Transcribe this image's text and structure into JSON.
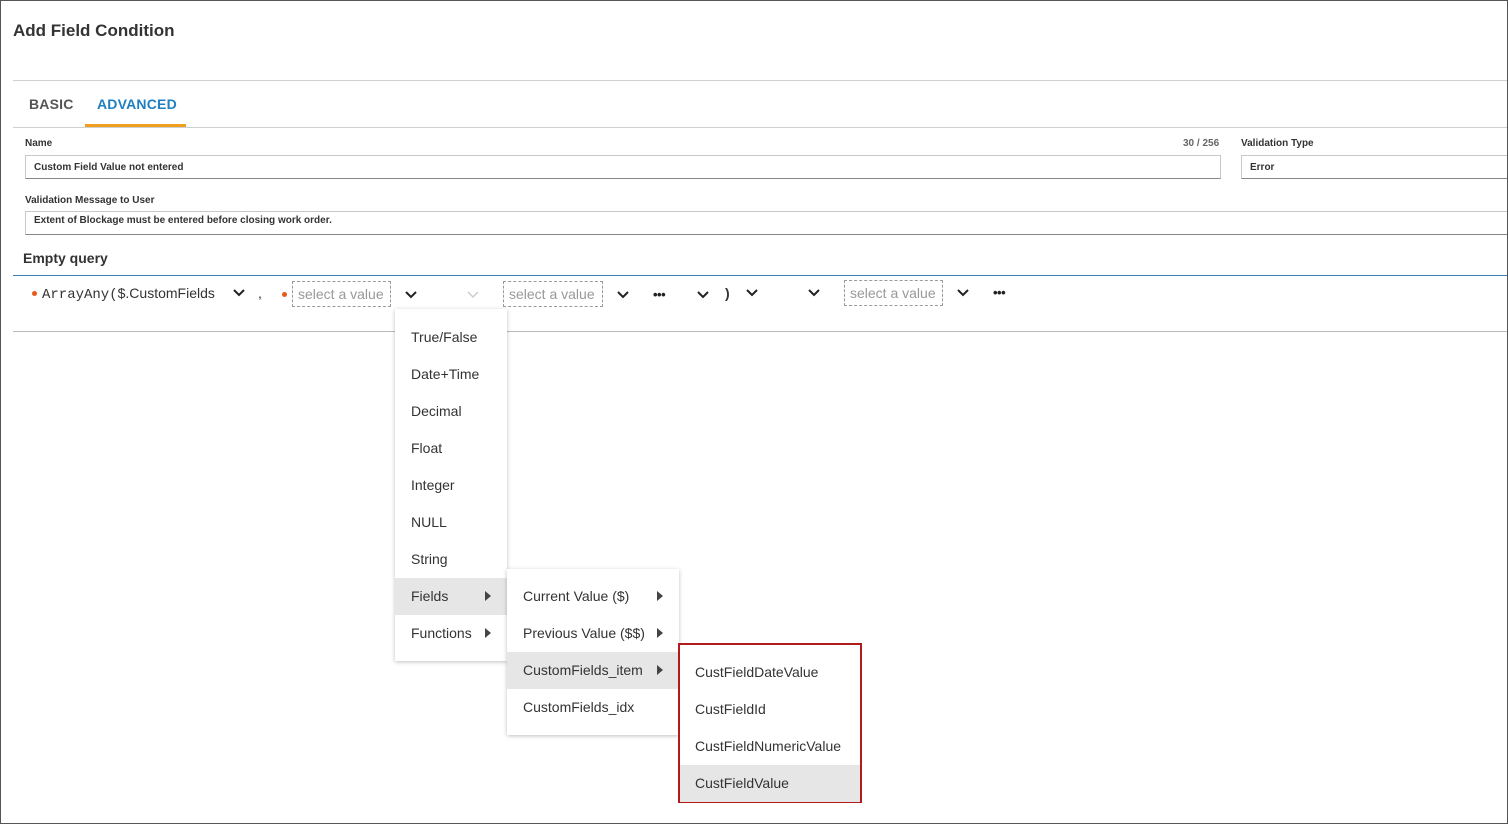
{
  "dialog": {
    "title": "Add Field Condition"
  },
  "tabs": [
    {
      "label": "BASIC",
      "active": false
    },
    {
      "label": "ADVANCED",
      "active": true
    }
  ],
  "form": {
    "name_label": "Name",
    "name_counter": "30 / 256",
    "name_value": "Custom Field Value not entered",
    "validation_type_label": "Validation Type",
    "validation_type_value": "Error",
    "message_label": "Validation Message to User",
    "message_value": "Extent of Blockage must be entered before closing work order."
  },
  "query": {
    "title": "Empty query",
    "function_text": "ArrayAny(",
    "field_text": "$.CustomFields",
    "comma": ",",
    "placeholder": "select a value",
    "paren_close": ")",
    "ellipsis": "•••"
  },
  "menus": {
    "type_menu": [
      {
        "label": "True/False",
        "submenu": false,
        "highlighted": false
      },
      {
        "label": "Date+Time",
        "submenu": false,
        "highlighted": false
      },
      {
        "label": "Decimal",
        "submenu": false,
        "highlighted": false
      },
      {
        "label": "Float",
        "submenu": false,
        "highlighted": false
      },
      {
        "label": "Integer",
        "submenu": false,
        "highlighted": false
      },
      {
        "label": "NULL",
        "submenu": false,
        "highlighted": false
      },
      {
        "label": "String",
        "submenu": false,
        "highlighted": false
      },
      {
        "label": "Fields",
        "submenu": true,
        "highlighted": true
      },
      {
        "label": "Functions",
        "submenu": true,
        "highlighted": false
      }
    ],
    "fields_menu": [
      {
        "label": "Current Value ($)",
        "submenu": true,
        "highlighted": false
      },
      {
        "label": "Previous Value ($$)",
        "submenu": true,
        "highlighted": false
      },
      {
        "label": "CustomFields_item",
        "submenu": true,
        "highlighted": true
      },
      {
        "label": "CustomFields_idx",
        "submenu": false,
        "highlighted": false
      }
    ],
    "item_menu": [
      {
        "label": "CustFieldDateValue",
        "highlighted": false
      },
      {
        "label": "CustFieldId",
        "highlighted": false
      },
      {
        "label": "CustFieldNumericValue",
        "highlighted": false
      },
      {
        "label": "CustFieldValue",
        "highlighted": true
      }
    ],
    "highlight_border_color": "#b01c1c"
  },
  "colors": {
    "accent_blue": "#1f7fc0",
    "tab_underline": "#f0a020",
    "required_dot": "#e85a1a"
  }
}
